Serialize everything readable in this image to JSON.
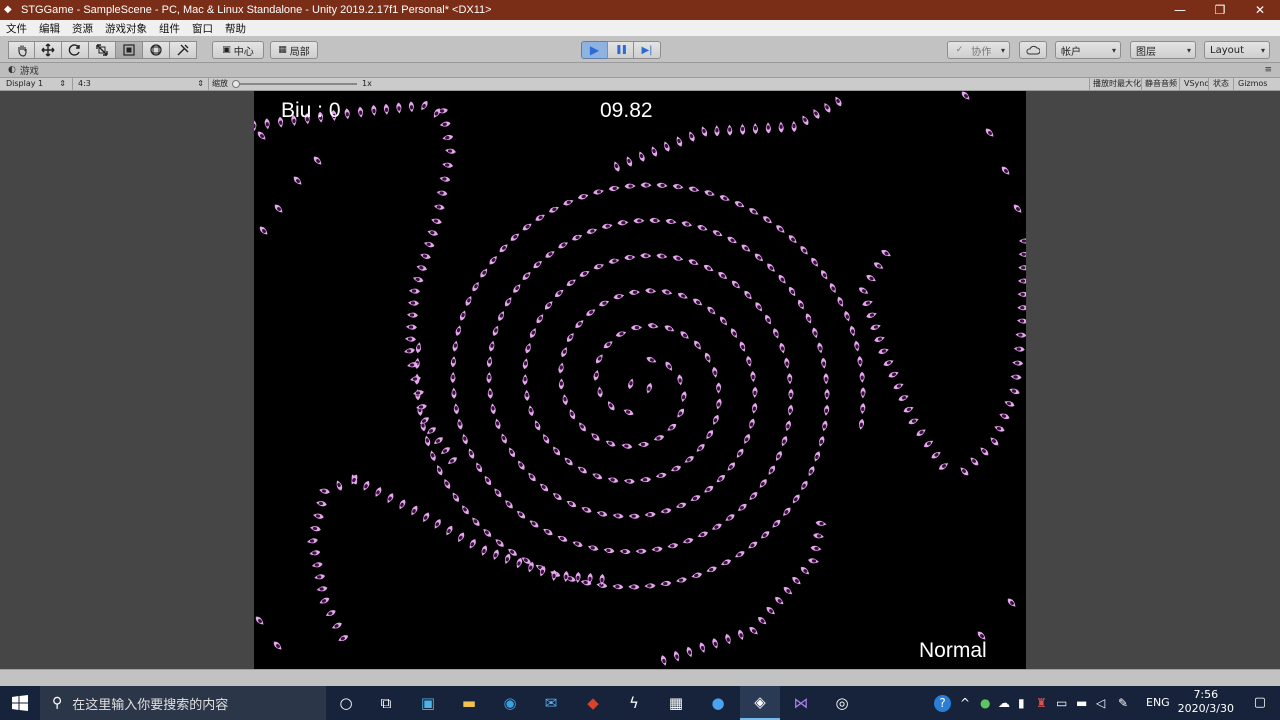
{
  "window": {
    "title": "STGGame - SampleScene - PC, Mac & Linux Standalone - Unity 2019.2.17f1 Personal* <DX11>",
    "controls": {
      "minimize": "—",
      "maximize": "❐",
      "close": "✕"
    }
  },
  "menu": [
    "文件",
    "编辑",
    "资源",
    "游戏对象",
    "组件",
    "窗口",
    "帮助"
  ],
  "toolbar": {
    "tools": [
      "hand-icon",
      "move-icon",
      "rotate-icon",
      "scale-icon",
      "rect-tool-icon",
      "transform-icon",
      "custom-tool-icon"
    ],
    "pivot_label": "中心",
    "local_label": "局部",
    "play_icon": "▶",
    "pause_icon": "❚❚",
    "step_icon": "▶|",
    "collab_label": "协作",
    "account_label": "帐户",
    "layers_label": "图层",
    "layout_label": "Layout"
  },
  "tab": {
    "label": "游戏"
  },
  "gamebar": {
    "display": "Display 1",
    "aspect": "4:3",
    "scale_label": "缩放",
    "scale_value": "1x",
    "maximize_on_play": "播放时最大化",
    "mute_audio": "静音音频",
    "vsync": "VSync",
    "stats": "状态",
    "gizmos": "Gizmos"
  },
  "game": {
    "score_text": "Biu : 0",
    "timer": "09.82",
    "difficulty": "Normal",
    "bullet_color": "#e6a8ec",
    "bullet_core": "#3a1240"
  },
  "taskbar": {
    "search_placeholder": "在这里输入你要搜索的内容",
    "language": "ENG",
    "time": "7:56",
    "date": "2020/3/30",
    "help_icon": "?"
  }
}
